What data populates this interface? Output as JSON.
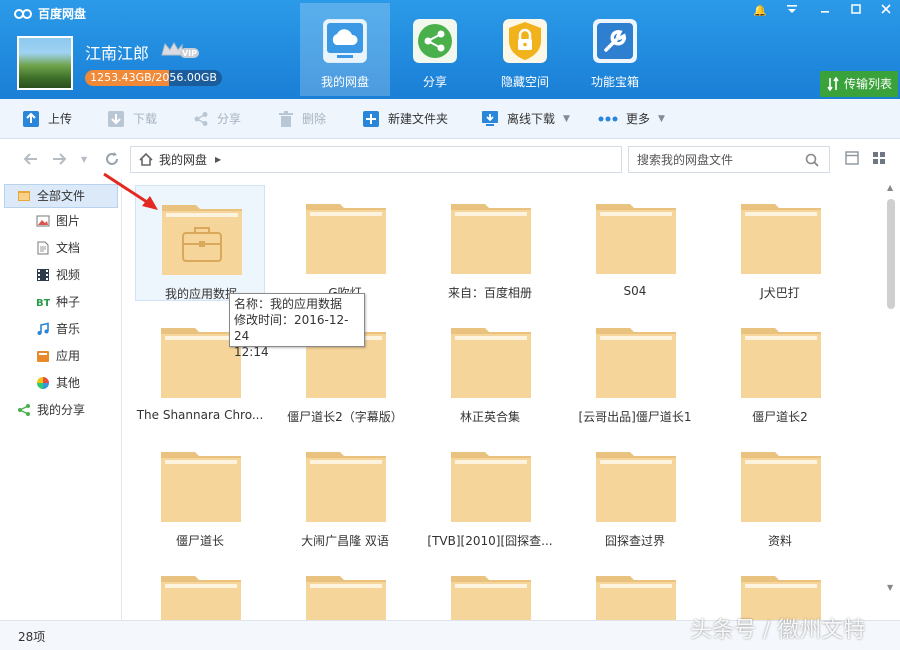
{
  "app": {
    "title": "百度网盘"
  },
  "user": {
    "name": "江南江郎",
    "vip": "VIP",
    "quota_text": "1253.43GB/2056.00GB",
    "quota_used_fraction": 0.61
  },
  "nav": [
    {
      "label": "我的网盘",
      "icon": "cloud-icon",
      "active": true
    },
    {
      "label": "分享",
      "icon": "share-icon",
      "active": false
    },
    {
      "label": "隐藏空间",
      "icon": "lock-icon",
      "active": false
    },
    {
      "label": "功能宝箱",
      "icon": "toolbox-icon",
      "active": false
    }
  ],
  "transfer": {
    "label": "传输列表"
  },
  "toolbar": {
    "upload": "上传",
    "download": "下载",
    "share": "分享",
    "delete": "删除",
    "new_folder": "新建文件夹",
    "offline_download": "离线下载",
    "more": "更多"
  },
  "breadcrumb": {
    "home": "我的网盘"
  },
  "search": {
    "placeholder": "搜索我的网盘文件"
  },
  "sidebar": {
    "items": [
      {
        "label": "全部文件",
        "icon": "all-files-icon"
      },
      {
        "label": "图片",
        "icon": "image-icon"
      },
      {
        "label": "文档",
        "icon": "document-icon"
      },
      {
        "label": "视频",
        "icon": "video-icon"
      },
      {
        "label": "种子",
        "icon": "bt-icon"
      },
      {
        "label": "音乐",
        "icon": "music-icon"
      },
      {
        "label": "应用",
        "icon": "app-icon"
      },
      {
        "label": "其他",
        "icon": "other-icon"
      },
      {
        "label": "我的分享",
        "icon": "my-share-icon"
      }
    ]
  },
  "files": [
    "我的应用数据",
    "G吹灯",
    "来自：百度相册",
    "S04",
    "J犬巴打",
    "The Shannara Chro...",
    "僵尸道长2（字幕版）",
    "林正英合集",
    "[云哥出品]僵尸道长1",
    "僵尸道长2",
    "僵尸道长",
    "大闹广昌隆 双语",
    "[TVB][2010][囧探查...",
    "囧探查过界",
    "资料",
    "",
    "",
    "",
    "",
    ""
  ],
  "tooltip": {
    "name": "名称：我的应用数据",
    "mtime": "修改时间：2016-12-24",
    "mtime2": "12:14"
  },
  "status": {
    "count": "28项"
  },
  "watermark": "头条号 / 徽州文特",
  "colors": {
    "header": "#1a7fd6",
    "folder": "#f6d59a",
    "folder_dark": "#e9c27f",
    "transfer": "#3aa23a"
  }
}
